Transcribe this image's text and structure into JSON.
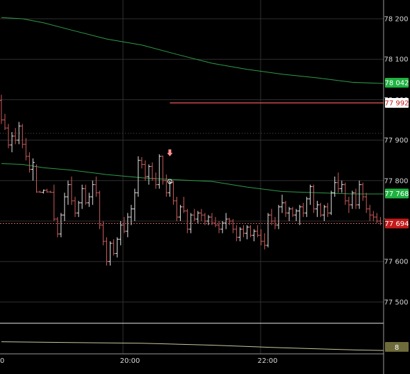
{
  "chart_data": {
    "type": "candlestick-ohlc",
    "price_axis": {
      "ticks": [
        {
          "value": 78200,
          "label": "78 200"
        },
        {
          "value": 78100,
          "label": "78 100"
        },
        {
          "value": 78000,
          "label": "78 000"
        },
        {
          "value": 77900,
          "label": "77 900"
        },
        {
          "value": 77800,
          "label": "77 800"
        },
        {
          "value": 77700,
          "label": "77 700"
        },
        {
          "value": 77600,
          "label": "77 600"
        },
        {
          "value": 77500,
          "label": "77 500"
        }
      ],
      "ylim": [
        77455,
        78232
      ]
    },
    "time_axis": {
      "ticks": [
        {
          "value": 0,
          "label": "0"
        },
        {
          "value": 1,
          "label": "20:00"
        },
        {
          "value": 2,
          "label": "22:00"
        }
      ]
    },
    "tags": [
      {
        "name": "upper-ma",
        "value": 78042,
        "label": "78 042",
        "bg": "#1fb241",
        "fg": "#ffffff"
      },
      {
        "name": "resistance",
        "value": 77992,
        "label": "77 992",
        "bg": "#ffffff",
        "fg": "#c41a1a"
      },
      {
        "name": "lower-ma",
        "value": 77768,
        "label": "77 768",
        "bg": "#1fb241",
        "fg": "#ffffff"
      },
      {
        "name": "last-price",
        "value": 77694,
        "label": "77 694",
        "bg": "#c41a1a",
        "fg": "#ffffff"
      }
    ],
    "resistance_line": {
      "value": 77992,
      "from_bar": 48
    },
    "dotted_level": 77917,
    "upper_ma": [
      {
        "i": 0,
        "v": 78203
      },
      {
        "i": 6,
        "v": 78200
      },
      {
        "i": 12,
        "v": 78190
      },
      {
        "i": 20,
        "v": 78172
      },
      {
        "i": 30,
        "v": 78150
      },
      {
        "i": 40,
        "v": 78135
      },
      {
        "i": 50,
        "v": 78112
      },
      {
        "i": 60,
        "v": 78090
      },
      {
        "i": 70,
        "v": 78075
      },
      {
        "i": 80,
        "v": 78063
      },
      {
        "i": 90,
        "v": 78054
      },
      {
        "i": 100,
        "v": 78043
      },
      {
        "i": 109,
        "v": 78040
      }
    ],
    "lower_ma": [
      {
        "i": 0,
        "v": 77842
      },
      {
        "i": 6,
        "v": 77840
      },
      {
        "i": 12,
        "v": 77832
      },
      {
        "i": 20,
        "v": 77826
      },
      {
        "i": 30,
        "v": 77815
      },
      {
        "i": 40,
        "v": 77807
      },
      {
        "i": 50,
        "v": 77802
      },
      {
        "i": 60,
        "v": 77798
      },
      {
        "i": 70,
        "v": 77784
      },
      {
        "i": 80,
        "v": 77773
      },
      {
        "i": 90,
        "v": 77770
      },
      {
        "i": 100,
        "v": 77767
      },
      {
        "i": 109,
        "v": 77767
      }
    ],
    "bars": [
      [
        77998,
        78012,
        77940,
        77950
      ],
      [
        77950,
        77965,
        77925,
        77930
      ],
      [
        77930,
        77940,
        77880,
        77888
      ],
      [
        77888,
        77920,
        77870,
        77910
      ],
      [
        77910,
        77930,
        77890,
        77900
      ],
      [
        77900,
        77945,
        77890,
        77935
      ],
      [
        77935,
        77940,
        77880,
        77890
      ],
      [
        77890,
        77905,
        77850,
        77860
      ],
      [
        77860,
        77870,
        77820,
        77828
      ],
      [
        77828,
        77855,
        77800,
        77845
      ],
      [
        77835,
        77840,
        77770,
        77772
      ],
      [
        77772,
        77775,
        77770,
        77771
      ],
      [
        77771,
        77778,
        77768,
        77776
      ],
      [
        77776,
        77780,
        77770,
        77772
      ],
      [
        77772,
        77775,
        77770,
        77771
      ],
      [
        77771,
        77790,
        77700,
        77705
      ],
      [
        77705,
        77710,
        77660,
        77668
      ],
      [
        77668,
        77720,
        77660,
        77715
      ],
      [
        77715,
        77770,
        77700,
        77760
      ],
      [
        77760,
        77800,
        77740,
        77790
      ],
      [
        77790,
        77810,
        77740,
        77750
      ],
      [
        77750,
        77760,
        77710,
        77720
      ],
      [
        77720,
        77750,
        77710,
        77745
      ],
      [
        77745,
        77790,
        77730,
        77780
      ],
      [
        77780,
        77790,
        77740,
        77745
      ],
      [
        77745,
        77770,
        77735,
        77760
      ],
      [
        77760,
        77800,
        77740,
        77790
      ],
      [
        77790,
        77810,
        77760,
        77770
      ],
      [
        77770,
        77775,
        77680,
        77690
      ],
      [
        77690,
        77700,
        77640,
        77650
      ],
      [
        77650,
        77660,
        77590,
        77600
      ],
      [
        77600,
        77650,
        77590,
        77645
      ],
      [
        77645,
        77655,
        77615,
        77620
      ],
      [
        77620,
        77660,
        77610,
        77655
      ],
      [
        77655,
        77700,
        77640,
        77690
      ],
      [
        77690,
        77710,
        77670,
        77675
      ],
      [
        77675,
        77720,
        77660,
        77710
      ],
      [
        77710,
        77740,
        77690,
        77730
      ],
      [
        77730,
        77780,
        77700,
        77770
      ],
      [
        77770,
        77860,
        77760,
        77850
      ],
      [
        77850,
        77858,
        77830,
        77840
      ],
      [
        77840,
        77850,
        77800,
        77810
      ],
      [
        77810,
        77840,
        77790,
        77835
      ],
      [
        77835,
        77845,
        77800,
        77805
      ],
      [
        77805,
        77820,
        77780,
        77790
      ],
      [
        77790,
        77865,
        77780,
        77860
      ],
      [
        77860,
        77862,
        77790,
        77800
      ],
      [
        77800,
        77815,
        77760,
        77770
      ],
      [
        77770,
        77800,
        77760,
        77795
      ],
      [
        77795,
        77800,
        77740,
        77750
      ],
      [
        77750,
        77760,
        77700,
        77710
      ],
      [
        77710,
        77740,
        77700,
        77735
      ],
      [
        77735,
        77760,
        77720,
        77725
      ],
      [
        77725,
        77730,
        77670,
        77680
      ],
      [
        77680,
        77720,
        77670,
        77715
      ],
      [
        77715,
        77730,
        77700,
        77705
      ],
      [
        77705,
        77725,
        77695,
        77720
      ],
      [
        77720,
        77730,
        77700,
        77715
      ],
      [
        77715,
        77720,
        77690,
        77700
      ],
      [
        77700,
        77715,
        77690,
        77710
      ],
      [
        77710,
        77720,
        77690,
        77695
      ],
      [
        77695,
        77710,
        77685,
        77690
      ],
      [
        77690,
        77700,
        77670,
        77680
      ],
      [
        77680,
        77700,
        77670,
        77695
      ],
      [
        77695,
        77720,
        77680,
        77705
      ],
      [
        77705,
        77708,
        77690,
        77700
      ],
      [
        77700,
        77705,
        77670,
        77680
      ],
      [
        77680,
        77690,
        77650,
        77660
      ],
      [
        77660,
        77685,
        77650,
        77680
      ],
      [
        77680,
        77690,
        77660,
        77670
      ],
      [
        77670,
        77690,
        77655,
        77685
      ],
      [
        77685,
        77690,
        77660,
        77665
      ],
      [
        77665,
        77680,
        77650,
        77675
      ],
      [
        77675,
        77690,
        77660,
        77665
      ],
      [
        77665,
        77680,
        77640,
        77650
      ],
      [
        77650,
        77670,
        77630,
        77640
      ],
      [
        77640,
        77720,
        77635,
        77715
      ],
      [
        77715,
        77730,
        77690,
        77700
      ],
      [
        77700,
        77710,
        77680,
        77690
      ],
      [
        77690,
        77740,
        77680,
        77735
      ],
      [
        77735,
        77765,
        77720,
        77745
      ],
      [
        77745,
        77750,
        77710,
        77720
      ],
      [
        77720,
        77735,
        77700,
        77730
      ],
      [
        77730,
        77735,
        77710,
        77715
      ],
      [
        77715,
        77730,
        77700,
        77725
      ],
      [
        77725,
        77740,
        77690,
        77735
      ],
      [
        77735,
        77745,
        77710,
        77720
      ],
      [
        77720,
        77760,
        77710,
        77755
      ],
      [
        77755,
        77790,
        77740,
        77785
      ],
      [
        77785,
        77790,
        77720,
        77730
      ],
      [
        77730,
        77750,
        77710,
        77740
      ],
      [
        77740,
        77745,
        77710,
        77715
      ],
      [
        77715,
        77740,
        77700,
        77735
      ],
      [
        77735,
        77745,
        77710,
        77720
      ],
      [
        77720,
        77775,
        77715,
        77770
      ],
      [
        77770,
        77810,
        77760,
        77795
      ],
      [
        77795,
        77820,
        77770,
        77780
      ],
      [
        77780,
        77800,
        77770,
        77790
      ],
      [
        77790,
        77795,
        77740,
        77750
      ],
      [
        77750,
        77760,
        77720,
        77740
      ],
      [
        77740,
        77775,
        77730,
        77770
      ],
      [
        77770,
        77780,
        77730,
        77740
      ],
      [
        77740,
        77800,
        77730,
        77790
      ],
      [
        77790,
        77795,
        77750,
        77760
      ],
      [
        77760,
        77770,
        77720,
        77730
      ],
      [
        77730,
        77740,
        77700,
        77715
      ],
      [
        77715,
        77725,
        77700,
        77710
      ],
      [
        77710,
        77720,
        77695,
        77700
      ],
      [
        77700,
        77710,
        77690,
        77694
      ]
    ],
    "signals": [
      {
        "type": "sell-arrow",
        "bar": 48,
        "price": 77860,
        "color": "#ff8f8f"
      },
      {
        "type": "circle",
        "bar": 48,
        "price": 77798,
        "color": "#ffffff"
      }
    ],
    "indicator": {
      "value_label": "8",
      "tag_bg": "#6e6b3b",
      "line": [
        {
          "i": 0,
          "v": 0.62
        },
        {
          "i": 20,
          "v": 0.65
        },
        {
          "i": 40,
          "v": 0.68
        },
        {
          "i": 60,
          "v": 0.75
        },
        {
          "i": 80,
          "v": 0.85
        },
        {
          "i": 100,
          "v": 0.93
        },
        {
          "i": 109,
          "v": 0.95
        }
      ]
    },
    "colors": {
      "up": "#e4e4e4",
      "down": "#cd5c5c",
      "ma": "#2d9c48",
      "grid": "#303030",
      "resistance": "#c94b4b",
      "axis_bg": "#000000"
    }
  }
}
